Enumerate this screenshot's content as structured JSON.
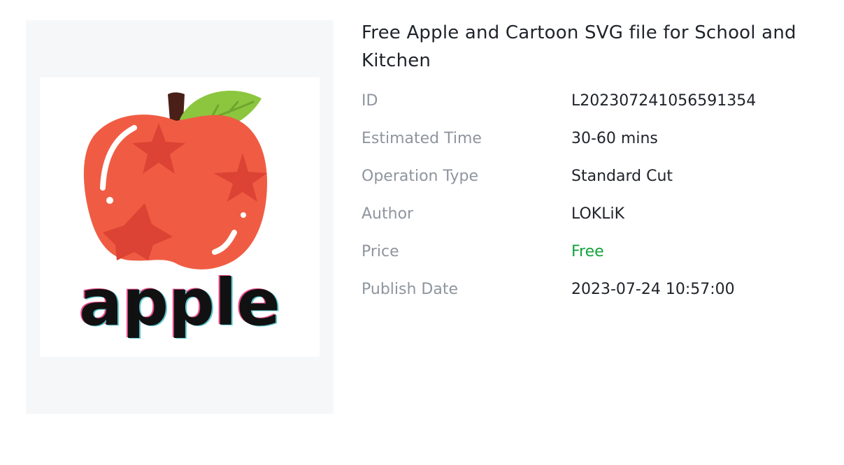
{
  "product": {
    "title": "Free Apple and Cartoon SVG file for School and Kitchen",
    "image": {
      "icon": "apple-cartoon-image",
      "lettering": "apple",
      "colors": {
        "apple": "#f05c43",
        "stars": "#dc4334",
        "leaf": "#8cc63f",
        "stem": "#4a1f17",
        "text": "#111111"
      }
    },
    "details": [
      {
        "label": "ID",
        "value": "L202307241056591354"
      },
      {
        "label": "Estimated Time",
        "value": "30-60 mins"
      },
      {
        "label": "Operation Type",
        "value": "Standard Cut"
      },
      {
        "label": "Author",
        "value": "LOKLiK"
      },
      {
        "label": "Price",
        "value": "Free",
        "color": "#13a33d"
      },
      {
        "label": "Publish Date",
        "value": "2023-07-24 10:57:00"
      }
    ]
  }
}
